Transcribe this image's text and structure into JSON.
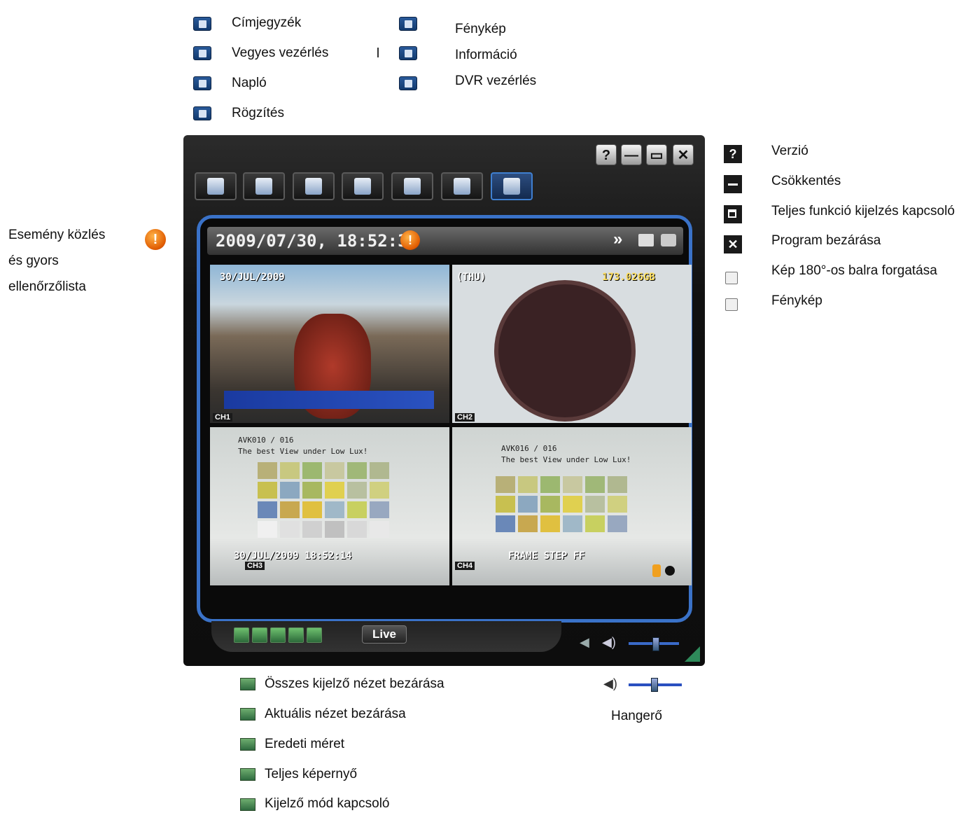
{
  "top_legend": {
    "items": [
      {
        "label": "Címjegyzék",
        "icon": "address-book-icon"
      },
      {
        "label": "Vegyes vezérlés",
        "icon": "misc-control-icon"
      },
      {
        "label": "Napló",
        "icon": "log-icon"
      },
      {
        "label": "Rögzítés",
        "icon": "record-icon"
      },
      {
        "label": "Fénykép",
        "icon": "snapshot-icon"
      },
      {
        "label": "Információ",
        "icon": "info-icon"
      },
      {
        "label": "DVR vezérlés",
        "icon": "dvr-control-icon"
      }
    ]
  },
  "event_note": {
    "lines": [
      "Esemény közlés",
      "és gyors",
      "ellenőrzőlista"
    ],
    "icon": "warning-icon"
  },
  "right_legend": {
    "items": [
      {
        "label": "Verzió",
        "icon": "question-icon"
      },
      {
        "label": "Csökkentés",
        "icon": "minimize-icon"
      },
      {
        "label": "Teljes funkció kijelzés kapcsoló",
        "icon": "window-toggle-icon"
      },
      {
        "label": "Program bezárása",
        "icon": "close-icon"
      },
      {
        "label": "Kép 180°-os balra forgatása",
        "icon": "rotate-icon"
      },
      {
        "label": "Fénykép",
        "icon": "snapshot-icon"
      }
    ]
  },
  "window": {
    "title_buttons": [
      "?",
      "—",
      "▭",
      "✕"
    ],
    "timestamp": "2009/07/30, 18:52:36",
    "live_label": "Live",
    "channels": [
      "CH1",
      "CH2",
      "CH3",
      "CH4"
    ],
    "osd": {
      "ch1_date": "30/JUL/2009",
      "ch2_day": "(THU)",
      "ch2_disk": "173.026GB",
      "ch3_line1": "AVK010 / 016",
      "ch3_line2": "The best View under Low Lux!",
      "ch3_date": "30/JUL/2009  18:52:14",
      "ch4_line1": "AVK016 / 016",
      "ch4_line2": "The best View under Low Lux!",
      "ch4_status": "FRAME  STEP FF"
    }
  },
  "bottom_legend": {
    "items": [
      {
        "label": "Összes kijelző nézet bezárása",
        "icon": "close-all-views-icon"
      },
      {
        "label": "Aktuális nézet bezárása",
        "icon": "close-current-view-icon"
      },
      {
        "label": "Eredeti méret",
        "icon": "original-size-icon"
      },
      {
        "label": "Teljes képernyő",
        "icon": "fullscreen-icon"
      },
      {
        "label": "Kijelző mód kapcsoló",
        "icon": "display-mode-icon"
      }
    ],
    "volume_label": "Hangerő"
  },
  "colors": {
    "accent": "#3a72c8",
    "warning": "#e05a00"
  }
}
